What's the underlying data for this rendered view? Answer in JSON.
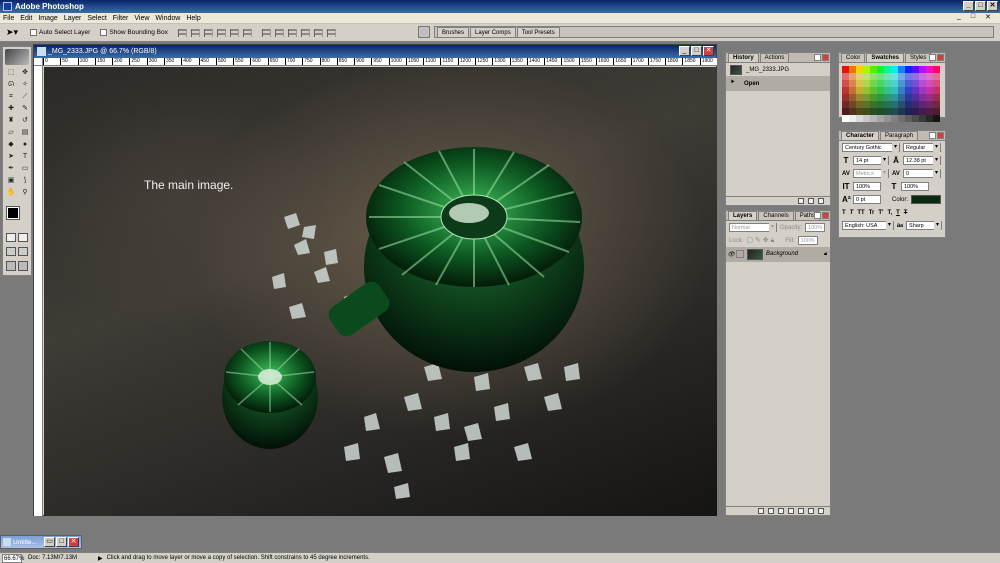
{
  "app": {
    "title": "Adobe Photoshop",
    "window_buttons": [
      "_",
      "□",
      "✕"
    ]
  },
  "menu": {
    "items": [
      "File",
      "Edit",
      "Image",
      "Layer",
      "Select",
      "Filter",
      "View",
      "Window",
      "Help"
    ]
  },
  "options_bar": {
    "auto_select_label": "Auto Select Layer",
    "show_bounding_label": "Show Bounding Box",
    "palette_tabs": [
      "Brushes",
      "Layer Comps",
      "Tool Presets"
    ]
  },
  "document": {
    "title": "_MG_2333.JPG @ 66.7% (RGB/8)",
    "ruler_ticks": [
      "0",
      "50",
      "100",
      "150",
      "200",
      "250",
      "300",
      "350",
      "400",
      "450",
      "500",
      "550",
      "600",
      "650",
      "700",
      "750",
      "800",
      "850",
      "900",
      "950",
      "1000",
      "1050",
      "1100",
      "1150",
      "1200",
      "1250",
      "1300",
      "1350",
      "1400",
      "1450",
      "1500",
      "1550",
      "1600",
      "1650",
      "1700",
      "1750",
      "1800",
      "1850",
      "1900"
    ],
    "caption": "The main image."
  },
  "history_panel": {
    "tabs": [
      "History",
      "Actions"
    ],
    "snapshot_label": "_MG_2333.JPG",
    "steps": [
      "Open"
    ]
  },
  "swatches_panel": {
    "tabs": [
      "Color",
      "Swatches",
      "Styles"
    ]
  },
  "character_panel": {
    "tabs": [
      "Character",
      "Paragraph"
    ],
    "font_family": "Century Gothic",
    "font_style": "Regular",
    "font_size": "14 pt",
    "leading": "12.38 pt",
    "kerning": "Metrics",
    "tracking": "0",
    "vertical_scale": "100%",
    "horizontal_scale": "100%",
    "baseline_shift": "0 pt",
    "color_label": "Color:",
    "color_value": "#0b2a10",
    "language": "English: USA",
    "antialias_prefix": "a",
    "antialias_glyph": "a",
    "antialias": "Sharp",
    "style_buttons": [
      "T",
      "T",
      "TT",
      "Tr",
      "T'",
      "T,",
      "T",
      "T"
    ]
  },
  "layers_panel": {
    "tabs": [
      "Layers",
      "Channels",
      "Paths"
    ],
    "blend_mode": "Normal",
    "opacity_label": "Opacity:",
    "opacity_value": "100%",
    "lock_label": "Lock:",
    "fill_label": "Fill:",
    "fill_value": "100%",
    "layer_name": "Background"
  },
  "minimized_doc": {
    "title": "Untitle..."
  },
  "status_bar": {
    "zoom": "66.67%",
    "doc_info": "Doc: 7.13M/7.13M",
    "hint": "Click and drag to move layer or move a copy of selection. Shift constrains to 45 degree increments."
  },
  "colors": {
    "title_bar": "#0a246a",
    "panel_bg": "#d4d0c8",
    "workspace": "#7a7a7a"
  }
}
